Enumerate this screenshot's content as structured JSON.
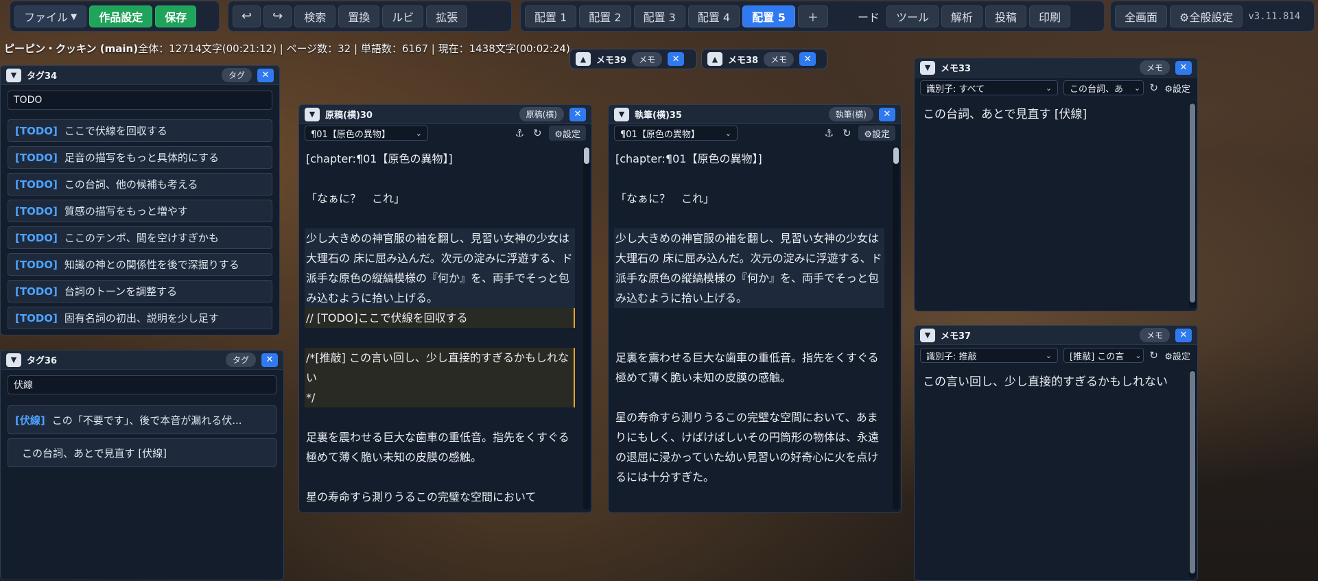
{
  "toolbar": {
    "file": "ファイル",
    "file_chevron": "▼",
    "settings": "作品設定",
    "save": "保存",
    "undo": "↩",
    "redo": "↪",
    "search": "検索",
    "replace": "置換",
    "ruby": "ルビ",
    "extend": "拡張",
    "layouts": [
      "配置 1",
      "配置 2",
      "配置 3",
      "配置 4",
      "配置 5"
    ],
    "add_layout": "＋",
    "partial_mode": "ード",
    "tools": "ツール",
    "analysis": "解析",
    "post": "投稿",
    "print": "印刷",
    "fullscreen": "全画面",
    "general_settings": "⚙全般設定",
    "version": "v3.11.814"
  },
  "status": {
    "title": "ピーピン・クッキン (main)",
    "stats": "全体：12714文字(00:21:12) | ページ数：32 | 単語数：6167 | 現在：1438文字(00:02:24)"
  },
  "pills": [
    {
      "title": "メモ39",
      "badge": "メモ"
    },
    {
      "title": "メモ38",
      "badge": "メモ"
    }
  ],
  "tag34": {
    "title": "タグ34",
    "badge": "タグ",
    "filter": "TODO",
    "items": [
      {
        "key": "[TODO]",
        "text": "ここで伏線を回収する"
      },
      {
        "key": "[TODO]",
        "text": "足音の描写をもっと具体的にする"
      },
      {
        "key": "[TODO]",
        "text": "この台詞、他の候補も考える"
      },
      {
        "key": "[TODO]",
        "text": "質感の描写をもっと増やす"
      },
      {
        "key": "[TODO]",
        "text": "ここのテンポ、間を空けすぎかも"
      },
      {
        "key": "[TODO]",
        "text": "知識の神との関係性を後で深掘りする"
      },
      {
        "key": "[TODO]",
        "text": "台詞のトーンを調整する"
      },
      {
        "key": "[TODO]",
        "text": "固有名詞の初出、説明を少し足す"
      }
    ]
  },
  "tag36": {
    "title": "タグ36",
    "badge": "タグ",
    "filter": "伏線",
    "items": [
      {
        "key": "[伏線]",
        "text": "この「不要です」、後で本音が漏れる伏..."
      },
      {
        "key": "",
        "text": "この台詞、あとで見直す [伏線]"
      }
    ]
  },
  "draft": {
    "title": "原稿(横)30",
    "badge": "原稿(横)",
    "chapter": "¶01【原色の異物】",
    "settings": "⚙設定",
    "lines": {
      "chapter_tag": "[chapter:¶01【原色の異物】]",
      "quote": "「なぁに？　これ」",
      "para1": "少し大きめの神官服の袖を翻し、見習い女神の少女は大理石の 床に屈み込んだ。次元の淀みに浮遊する、ド派手な原色の縦縞模様の『何か』を、両手でそっと包み込むように拾い上げる。",
      "todo": "// [TODO]ここで伏線を回収する",
      "comment": "/*[推敲] この言い回し、少し直接的すぎるかもしれない\n*/",
      "para2": "足裏を震わせる巨大な歯車の重低音。指先をくすぐる極めて薄く脆い未知の皮膜の感触。",
      "para3": "星の寿命すら測りうるこの完璧な空間において"
    }
  },
  "writing": {
    "title": "執筆(横)35",
    "badge": "執筆(横)",
    "chapter": "¶01【原色の異物】",
    "settings": "⚙設定",
    "lines": {
      "chapter_tag": "[chapter:¶01【原色の異物】]",
      "quote": "「なぁに？　これ」",
      "para1": "少し大きめの神官服の袖を翻し、見習い女神の少女は大理石の 床に屈み込んだ。次元の淀みに浮遊する、ド派手な原色の縦縞模様の『何か』を、両手でそっと包み込むように拾い上げる。",
      "para2": "足裏を震わせる巨大な歯車の重低音。指先をくすぐる極めて薄く脆い未知の皮膜の感触。",
      "para3": "星の寿命すら測りうるこの完璧な空間において、あまりにもしく、けばけばしいその円筒形の物体は、永遠の退屈に浸かっていた幼い見習いの好奇心に火を点けるには十分すぎた。"
    }
  },
  "memo33": {
    "title": "メモ33",
    "badge": "メモ",
    "filter_id": "識別子: すべて",
    "filter_text": "この台詞、あ",
    "settings": "⚙設定",
    "body": "この台詞、あとで見直す [伏線]"
  },
  "memo37": {
    "title": "メモ37",
    "badge": "メモ",
    "filter_id": "識別子: 推敲",
    "filter_text": "[推敲] この言",
    "settings": "⚙設定",
    "body": "この言い回し、少し直接的すぎるかもしれない"
  }
}
